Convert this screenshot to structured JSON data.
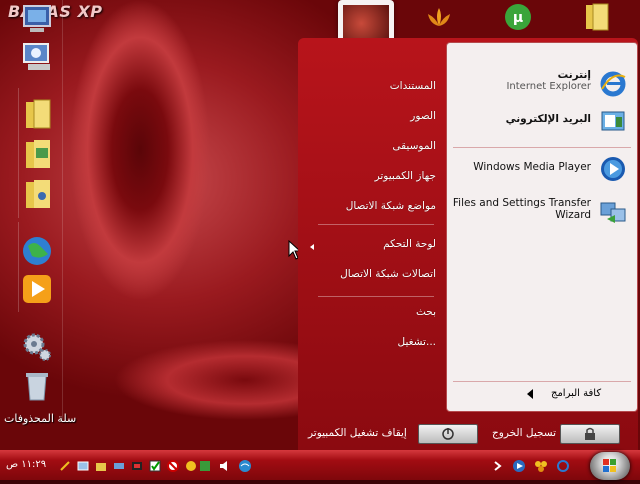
{
  "desktop": {
    "brand": "BAAAS XP",
    "recycle_bin_label": "سلة المحذوفات"
  },
  "start_menu": {
    "pinned": [
      {
        "title": "إنترنت",
        "subtitle": "Internet Explorer",
        "icon": "internet-explorer-icon"
      },
      {
        "title": "البريد الإلكتروني",
        "subtitle": "",
        "icon": "email-icon"
      }
    ],
    "recent": [
      {
        "title": "Windows Media Player",
        "icon": "media-player-icon"
      },
      {
        "title": "Files and Settings Transfer Wizard",
        "icon": "transfer-wizard-icon"
      }
    ],
    "all_programs": "كافة البرامج",
    "places": [
      "المستندات",
      "الصور",
      "الموسيقى",
      "جهاز الكمبيوتر",
      "مواضع شبكة الاتصال"
    ],
    "settings": [
      "لوحة التحكم",
      "اتصالات شبكة الاتصال"
    ],
    "tools": [
      "بحث",
      "تشغيل..."
    ],
    "logoff": "تسجيل الخروج",
    "shutdown": "إيقاف تشغيل الكمبيوتر"
  },
  "taskbar": {
    "clock": "١١:٢٩ ص"
  }
}
